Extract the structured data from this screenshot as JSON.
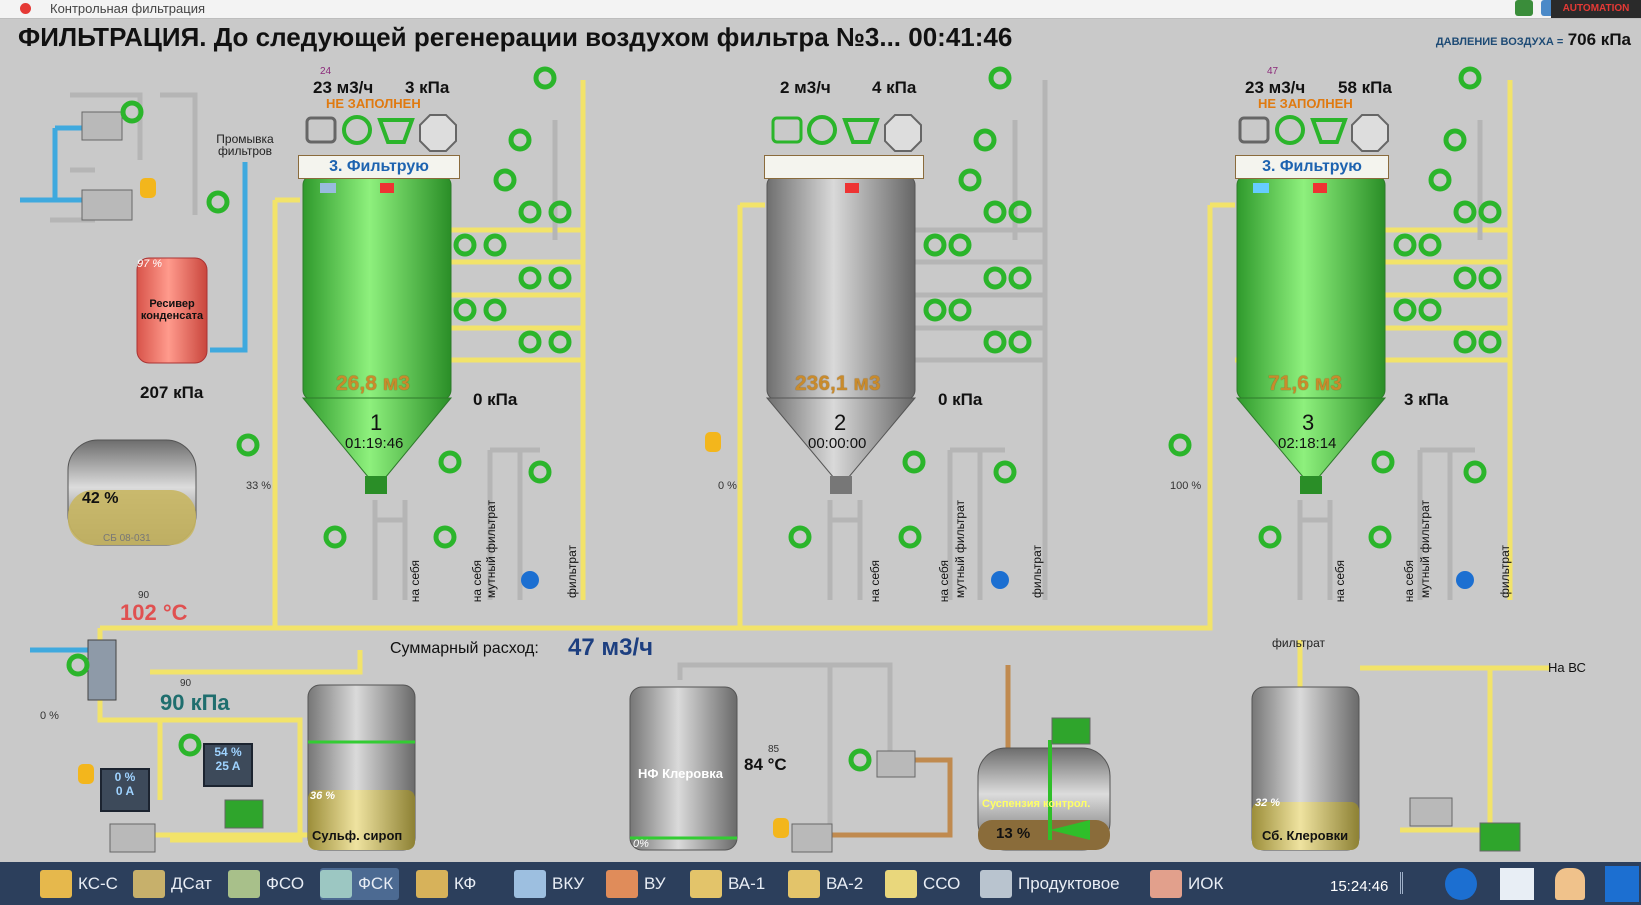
{
  "window_title": "Контрольная фильтрация",
  "headline": "ФИЛЬТРАЦИЯ. До следующей регенерации воздухом  фильтра №3... 00:41:46",
  "air_pressure": {
    "label": "ДАВЛЕНИЕ ВОЗДУХА =",
    "value": "706 кПа"
  },
  "filters": [
    {
      "number": "1",
      "flow_small": "24",
      "flow": "23 м3/ч",
      "pressure": "3 кПа",
      "status": "НЕ ЗАПОЛНЕН",
      "mode": "3. Фильтрую",
      "volume": "26,8 м3",
      "timer": "01:19:46",
      "side_pressure": "0 кПа",
      "valve_pct": "33 %"
    },
    {
      "number": "2",
      "flow_small": "",
      "flow": "2 м3/ч",
      "pressure": "4 кПа",
      "status": "",
      "mode": "",
      "volume": "236,1 м3",
      "timer": "00:00:00",
      "side_pressure": "0 кПа",
      "valve_pct": "0 %"
    },
    {
      "number": "3",
      "flow_small": "47",
      "flow": "23 м3/ч",
      "pressure": "58 кПа",
      "status": "НЕ ЗАПОЛНЕН",
      "mode": "3. Фильтрую",
      "volume": "71,6 м3",
      "timer": "02:18:14",
      "side_pressure": "3 кПа",
      "valve_pct": "100 %"
    }
  ],
  "pipe_labels": {
    "to_self": "на себя",
    "turbid": "мутный фильтрат",
    "filtrate": "фильтрат",
    "flushing": "Промывка фильтров",
    "to_vs": "На ВС"
  },
  "receiver": {
    "name": "Ресивер конденсата",
    "level": "97 %",
    "pressure": "207 кПа"
  },
  "sb_tank": {
    "level": "42 %",
    "code": "СБ 08-031"
  },
  "heater": {
    "temp_small": "90",
    "temp": "102 °C",
    "pressure_small": "90",
    "pressure": "90 кПа",
    "valve_pct": "0 %"
  },
  "total_flow": {
    "label": "Суммарный расход:",
    "value": "47 м3/ч"
  },
  "pump_left": {
    "pct": "0 %",
    "amps": "0 A"
  },
  "pump_mid": {
    "pct": "54 %",
    "amps": "25 A"
  },
  "sulf_tank": {
    "name": "Сульф. сироп",
    "level": "36 %"
  },
  "nf_tank": {
    "name": "НФ Клеровка",
    "level": "0%",
    "temp_small": "85",
    "temp": "84 °C"
  },
  "susp_tank": {
    "name": "Суспензия контрол.",
    "level": "13 %"
  },
  "kl_tank": {
    "name": "Сб. Клеровки",
    "level": "32 %",
    "label_top": "фильтрат"
  },
  "taskbar": {
    "tabs": [
      "КС-С",
      "ДСат",
      "ФСО",
      "ФСК",
      "КФ",
      "ВКУ",
      "ВУ",
      "ВА-1",
      "ВА-2",
      "ССО",
      "Продуктовое",
      "ИОК"
    ],
    "active": "ФСК",
    "time": "15:24:46"
  },
  "colors": {
    "filter_green": "#4fc94a",
    "pipe_yellow": "#f2e36a",
    "pipe_grey": "#b5b5b5",
    "pipe_blue": "#3fa9de",
    "background": "#c9c9c9",
    "taskbar": "#2c3f5c"
  }
}
